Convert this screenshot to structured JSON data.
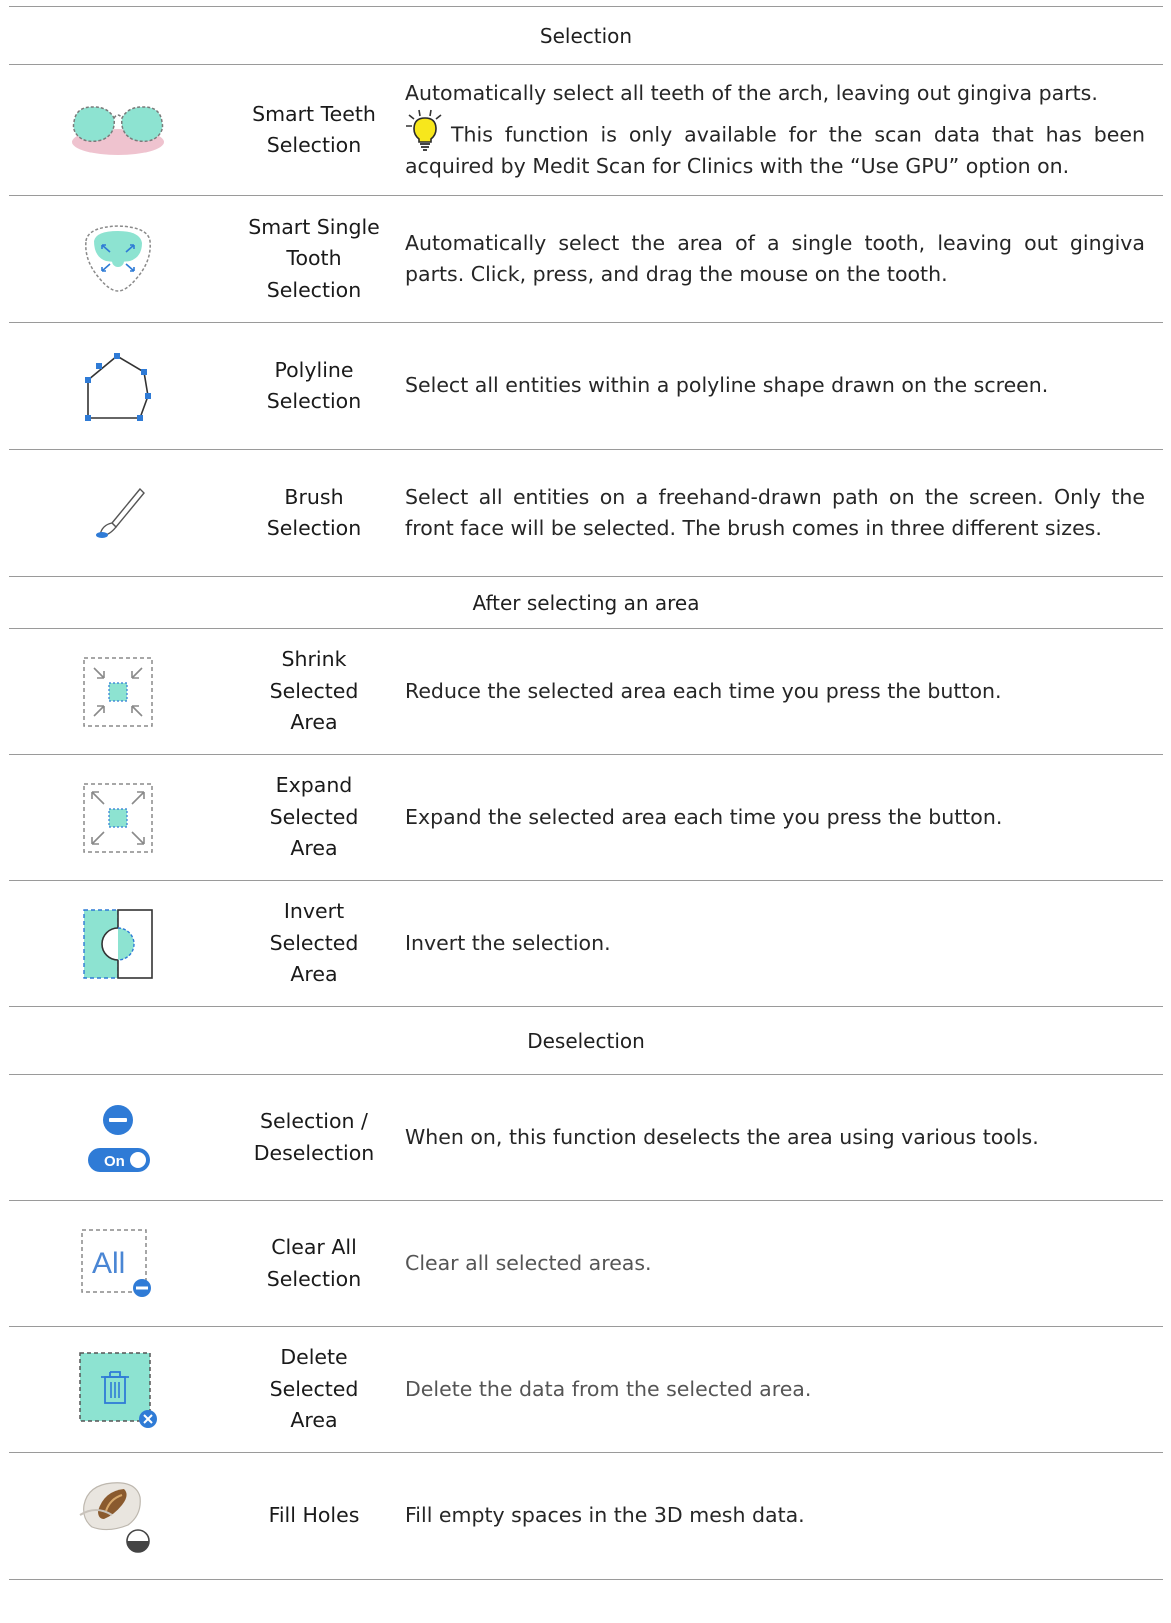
{
  "sections": [
    {
      "title": "Selection",
      "tools": [
        {
          "id": "smart-teeth",
          "name_lines": [
            "Smart Teeth",
            "Selection"
          ],
          "description": "Automatically select all teeth of the arch, leaving out gingiva parts.",
          "tip": "This function is only available for the scan data that has been acquired by Medit Scan for Clinics with the “Use GPU” option on.",
          "icon": "smart-teeth-selection-icon"
        },
        {
          "id": "smart-single-tooth",
          "name_lines": [
            "Smart Single",
            "Tooth",
            "Selection"
          ],
          "description": "Automatically select the area of a single tooth, leaving out gingiva parts. Click, press, and drag the mouse on the tooth.",
          "icon": "smart-single-tooth-selection-icon"
        },
        {
          "id": "polyline",
          "name_lines": [
            "Polyline",
            "Selection"
          ],
          "description": "Select all entities within a polyline shape drawn on the screen.",
          "icon": "polyline-selection-icon"
        },
        {
          "id": "brush",
          "name_lines": [
            "Brush",
            "Selection"
          ],
          "description": "Select all entities on a freehand-drawn path on the screen. Only the front face will be selected. The brush comes in three different sizes.",
          "icon": "brush-selection-icon"
        }
      ]
    },
    {
      "title": "After selecting an area",
      "tools": [
        {
          "id": "shrink",
          "name_lines": [
            "Shrink",
            "Selected",
            "Area"
          ],
          "description": "Reduce the selected area each time you press the button.",
          "icon": "shrink-selected-area-icon"
        },
        {
          "id": "expand",
          "name_lines": [
            "Expand",
            "Selected",
            "Area"
          ],
          "description": "Expand the selected area each time you press the button.",
          "icon": "expand-selected-area-icon"
        },
        {
          "id": "invert",
          "name_lines": [
            "Invert",
            "Selected",
            "Area"
          ],
          "description": "Invert the selection.",
          "icon": "invert-selected-area-icon"
        }
      ]
    },
    {
      "title": "Deselection",
      "tools": [
        {
          "id": "deselection",
          "name_lines": [
            "Selection /",
            "Deselection"
          ],
          "description": "When on, this function deselects the area using various tools.",
          "icon": "selection-deselection-toggle-icon",
          "toggle_label": "On"
        },
        {
          "id": "clear-all",
          "name_lines": [
            "Clear All",
            "Selection"
          ],
          "description": "Clear all selected areas.",
          "icon": "clear-all-selection-icon",
          "icon_text": "All"
        },
        {
          "id": "delete",
          "name_lines": [
            "Delete",
            "Selected",
            "Area"
          ],
          "description": "Delete the data from the selected area.",
          "icon": "delete-selected-area-icon"
        },
        {
          "id": "fill-holes",
          "name_lines": [
            "Fill Holes"
          ],
          "description": "Fill empty spaces in the 3D mesh data.",
          "icon": "fill-holes-icon"
        }
      ]
    }
  ],
  "colors": {
    "mint": "#8de3d1",
    "blue": "#2f7bd6",
    "gray_dash": "#8a8a8a",
    "rule": "#9a9a9a"
  }
}
